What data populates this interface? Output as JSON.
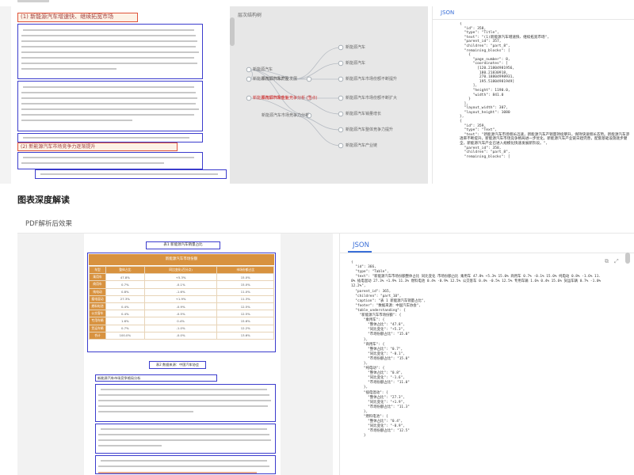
{
  "top_panel": {
    "document": {
      "heading_1": "(1) 新能源汽车增速快、继续拓宽市场",
      "heading_2": "(2) 新能源汽车市场竞争力逐渐提升"
    },
    "mindmap": {
      "title": "层次结构树",
      "left_nodes": [
        "新能源汽车",
        "新能源汽车市场发展",
        "新能源汽车市场竞争"
      ],
      "mid_nodes": [
        "新能源汽车产业发展",
        "新能源汽车企业竞争分析 (重点)",
        "新能源汽车市场竞争力分析"
      ],
      "right_nodes": [
        "新能源汽车",
        "新能源汽车",
        "新能源汽车市场份额不断提升",
        "新能源汽车市场份额不断扩大",
        "新能源汽车销量增长",
        "新能源汽车整体竞争力提升",
        "新能源汽车产业链"
      ]
    },
    "json": {
      "tab": "JSON",
      "code": "{\n  \"id\": 358,\n  \"type\": \"Title\",\n  \"text\": \"(1)新能源汽车增速快、继续拓宽市场\",\n  \"parent_id\": 357,\n  \"children\": \"part_8\",\n  \"remaining_blocks\": [\n    {\n      \"page_number\": 8,\n      \"coordinates\": [\n        [120.21804981956,\n         180.21830918,\n         270.18804998931,\n         195.51804981949]\n      ],\n      \"height\": 1190.0,\n      \"width\": 841.0\n    }\n  ],\n  \"layout_width\": 307,\n  \"layout_height\": 1080\n},\n{\n  \"id\": 359,\n  \"type\": \"Text\",\n  \"text\": \"新能源汽车市场增长迅速，新能源汽车产销量持续攀升，保持快速增长态势。新能源汽车渗透率不断提升，新能源汽车市场竞争格局进一步优化，新能源汽车产业链日趋完善，配套基础设施逐步健全，新能源汽车产业已进入规模化快速发展新阶段。\",\n  \"parent_id\": 358,\n  \"children\": \"part_8\",\n  \"remaining_blocks\": ["
    }
  },
  "section_title": "图表深度解读",
  "tab_label": "PDF解析后效果",
  "bottom_panel": {
    "document": {
      "table_caption": "表1 新能源汽车销量占比",
      "table_header": "新能源汽车市场份额",
      "columns": [
        "车型",
        "整体占比",
        "同比变化(百分点)",
        "市场份额占比"
      ],
      "rows": [
        [
          "乘用车",
          "47.8%",
          "+5.3%",
          "15.0%"
        ],
        [
          "商用车",
          "0.7%",
          "-0.1%",
          "15.0%"
        ],
        [
          "纯电动",
          "0.8%",
          "-1.6%",
          "11.0%"
        ],
        [
          "插电混动",
          "27.3%",
          "+1.9%",
          "11.3%"
        ],
        [
          "燃料电池",
          "0.4%",
          "-0.9%",
          "12.5%"
        ],
        [
          "公交客车",
          "0.4%",
          "-0.5%",
          "12.5%"
        ],
        [
          "专用车辆",
          "1.6%",
          "0.4%",
          "15.6%"
        ],
        [
          "货运车辆",
          "0.7%",
          "-1.0%",
          "12.2%"
        ],
        [
          "合计",
          "100.0%",
          "-0.0%",
          "13.6%"
        ]
      ],
      "subheading_1": "表2 数据来源：中国汽车协会",
      "subheading_2": "新能源汽车市场竞争格局分析"
    },
    "json": {
      "tab": "JSON",
      "code": "{\n  \"id\": 366,\n  \"type\": \"Table\",\n  \"text\": \"新能源汽车市场份额整体占比 同比变化 市场份额占比 乘用车 47.8% +5.3% 15.0% 商用车 0.7% -0.1% 15.0% 纯电动 0.8% -1.6% 11.0% 插电混动 27.3% +1.9% 11.3% 燃料电池 0.4% -0.9% 12.5% 公交客车 0.4% -0.5% 12.5% 专用车辆 1.6% 0.4% 15.6% 货运车辆 0.7% -1.0% 12.2%\",\n  \"parent_id\": 365,\n  \"children\": \"part_10\",\n  \"caption\": \"表 1 新能源汽车销量占比\",\n  \"footer\": \"数据来源：中国汽车协会\",\n  \"table_understanding\": {\n    \"新能源汽车市场份额\": {\n      \"乘用车\": {\n        \"整体占比\": \"47.8\",\n        \"同比变化\": \"+5.3\",\n        \"市场份额占比\": \"15.0\"\n      },\n      \"商用车\": {\n        \"整体占比\": \"0.7\",\n        \"同比变化\": \"-0.1\",\n        \"市场份额占比\": \"15.0\"\n      },\n      \"纯电动\": {\n        \"整体占比\": \"0.8\",\n        \"同比变化\": \"-1.6\",\n        \"市场份额占比\": \"11.0\"\n      },\n      \"插电混动\": {\n        \"整体占比\": \"27.3\",\n        \"同比变化\": \"+1.9\",\n        \"市场份额占比\": \"11.3\"\n      },\n      \"燃料电池\": {\n        \"整体占比\": \"0.4\",\n        \"同比变化\": \"-0.9\",\n        \"市场份额占比\": \"12.5\"\n      }"
    }
  }
}
